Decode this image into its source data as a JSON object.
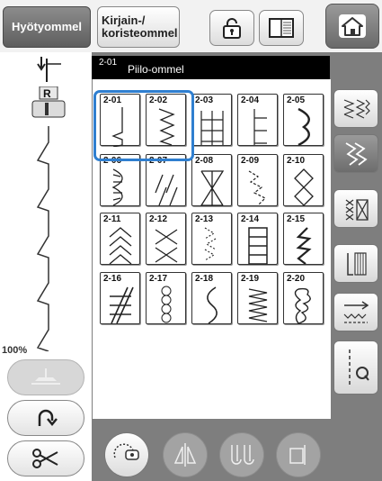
{
  "top": {
    "tab_utility": "Hyötyommel",
    "tab_character": "Kirjain-/\nkoristeommel"
  },
  "current_stitch": {
    "code": "2-01",
    "name": "Piilo-ommel"
  },
  "zoom": "100%",
  "stitches": [
    {
      "code": "2-01"
    },
    {
      "code": "2-02"
    },
    {
      "code": "2-03"
    },
    {
      "code": "2-04"
    },
    {
      "code": "2-05"
    },
    {
      "code": "2-06"
    },
    {
      "code": "2-07"
    },
    {
      "code": "2-08"
    },
    {
      "code": "2-09"
    },
    {
      "code": "2-10"
    },
    {
      "code": "2-11"
    },
    {
      "code": "2-12"
    },
    {
      "code": "2-13"
    },
    {
      "code": "2-14"
    },
    {
      "code": "2-15"
    },
    {
      "code": "2-16"
    },
    {
      "code": "2-17"
    },
    {
      "code": "2-18"
    },
    {
      "code": "2-19"
    },
    {
      "code": "2-20"
    }
  ],
  "selected": [
    "2-01",
    "2-02"
  ],
  "icons": {
    "top": [
      "lock-icon",
      "manual-book-icon",
      "home-icon"
    ],
    "left": [
      "needle-position-icon",
      "presser-foot-r-icon",
      "stitch-preview",
      "foot-pressure-icon",
      "reverse-icon",
      "scissors-icon"
    ],
    "right": [
      "category-basic-icon",
      "category-blind-icon",
      "category-decorative-icon",
      "category-satin-icon",
      "category-tapering-icon",
      "category-quilting-q-icon"
    ],
    "bottom": [
      "free-motion-icon",
      "mirror-icon",
      "twin-needle-icon",
      "single-needle-icon"
    ]
  },
  "colors": {
    "highlight": "#2f7fd0",
    "tab_active": "#6e6e6e",
    "panel": "#7e7e7e"
  }
}
